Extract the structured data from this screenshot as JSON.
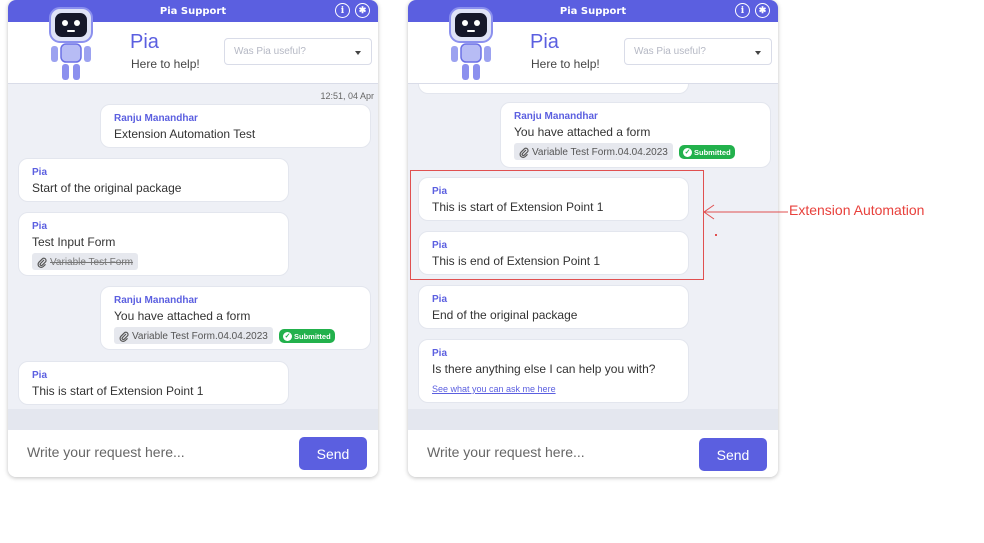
{
  "colors": {
    "brand": "#5b5fe0",
    "submitted": "#22b14c",
    "annotation": "#e8413c"
  },
  "widget": {
    "title": "Pia Support",
    "info_icon": "info-icon",
    "settings_icon": "gear-icon",
    "bot_name": "Pia",
    "bot_tagline": "Here to help!",
    "feedback_placeholder": "Was Pia useful?",
    "input_placeholder": "Write your request here...",
    "send_label": "Send"
  },
  "left_chat": {
    "timestamp": "12:51, 04 Apr",
    "messages": [
      {
        "sender": "Ranju Manandhar",
        "text": "Extension Automation Test"
      },
      {
        "sender": "Pia",
        "text": "Start of the original package"
      },
      {
        "sender": "Pia",
        "text": "Test Input Form",
        "attachment": "Variable Test Form"
      },
      {
        "sender": "Ranju Manandhar",
        "text": "You have attached a form",
        "attachment": "Variable Test Form.04.04.2023",
        "badge": "Submitted"
      },
      {
        "sender": "Pia",
        "text": "This is start of Extension Point 1"
      }
    ]
  },
  "right_chat": {
    "messages": [
      {
        "sender": "Ranju Manandhar",
        "text": "You have attached a form",
        "attachment": "Variable Test Form.04.04.2023",
        "badge": "Submitted"
      },
      {
        "sender": "Pia",
        "text": "This is start of Extension Point 1"
      },
      {
        "sender": "Pia",
        "text": "This is end of Extension Point 1"
      },
      {
        "sender": "Pia",
        "text": "End of the original package"
      },
      {
        "sender": "Pia",
        "text": "Is there anything else I can help you with?",
        "link": "See what you can ask me here"
      }
    ]
  },
  "annotation": {
    "label": "Extension Automation"
  }
}
